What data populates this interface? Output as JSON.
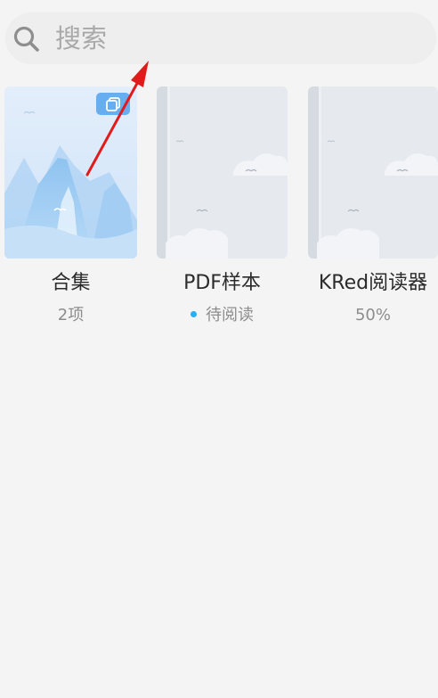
{
  "search": {
    "placeholder": "搜索",
    "icon": "search-icon"
  },
  "books": [
    {
      "title": "合集",
      "status": "2项",
      "badge_icon": "collection-icon"
    },
    {
      "title": "PDF样本",
      "status": "待阅读",
      "status_dot_color": "#2aaef2"
    },
    {
      "title": "KRed阅读器",
      "status": "50%"
    }
  ],
  "annotation": {
    "type": "arrow",
    "color": "#e11b1b"
  }
}
